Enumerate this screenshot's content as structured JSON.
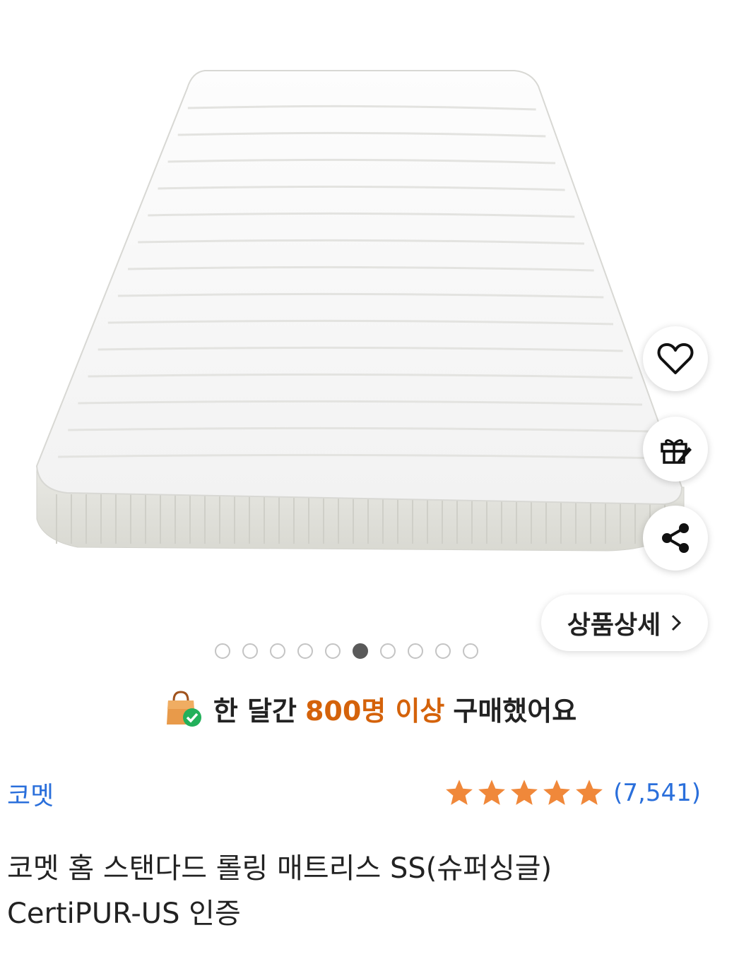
{
  "product_image": {
    "alt": "",
    "carousel": {
      "total": 10,
      "active_index": 5
    }
  },
  "actions": {
    "wishlist_icon": "heart-outline-icon",
    "gift_icon": "gift-icon",
    "share_icon": "share-icon"
  },
  "detail_button": {
    "label": "상품상세"
  },
  "social_proof": {
    "prefix": "한 달간",
    "highlight": "800명 이상",
    "suffix": "구매했어요",
    "highlight_color": "#d4620a"
  },
  "brand": {
    "name": "코멧",
    "color": "#2a6fdb"
  },
  "rating": {
    "stars": 5,
    "review_count": "(7,541)",
    "star_color": "#f0883a"
  },
  "title": {
    "line1": "코멧 홈 스탠다드 롤링 매트리스 SS(슈퍼싱글)",
    "line2": "CertiPUR-US 인증"
  }
}
